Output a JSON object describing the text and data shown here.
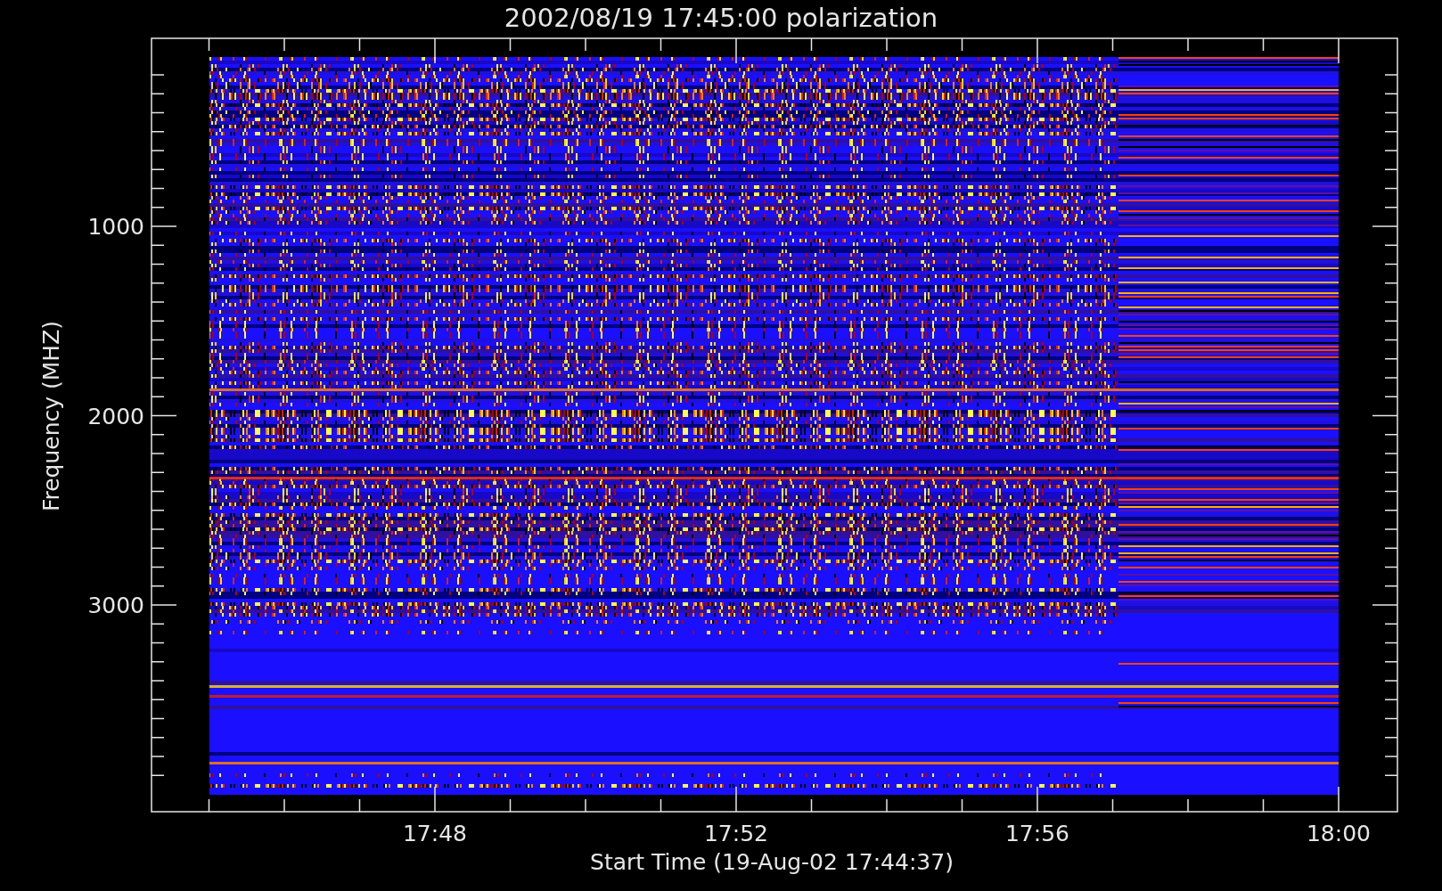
{
  "title": "2002/08/19 17:45:00 polarization",
  "y_axis": {
    "title": "Frequency (MHZ)",
    "tick_labels": [
      "1000",
      "2000",
      "3000"
    ]
  },
  "x_axis": {
    "title": "Start Time (19-Aug-02 17:44:37)",
    "tick_labels": [
      "17:48",
      "17:52",
      "17:56",
      "18:00"
    ]
  }
}
